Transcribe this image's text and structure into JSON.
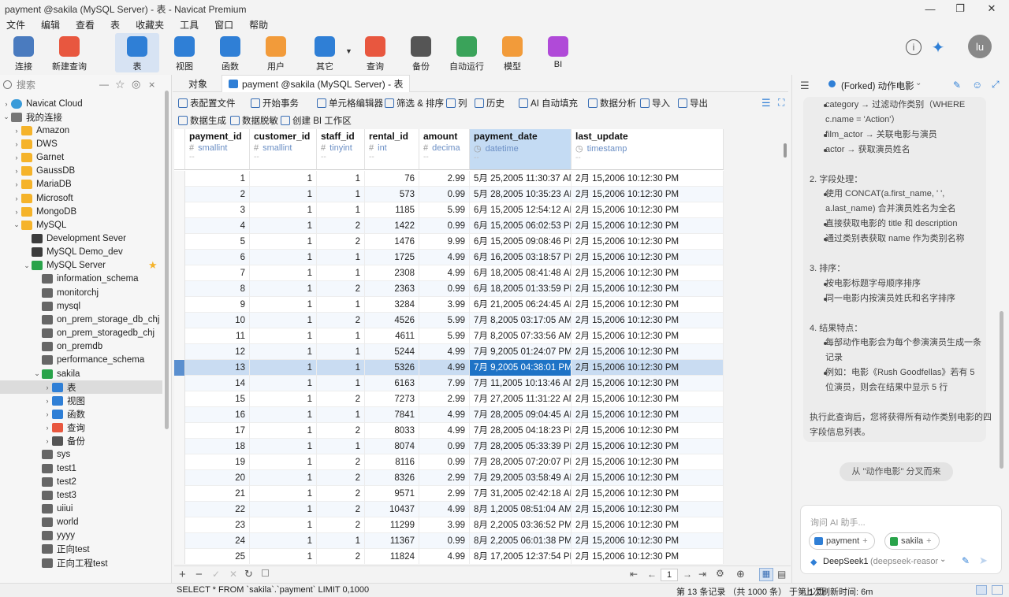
{
  "window": {
    "title": "payment @sakila (MySQL Server) - 表 - Navicat Premium",
    "minimize": "—",
    "maximize": "❐",
    "close": "✕"
  },
  "menu": [
    "文件",
    "编辑",
    "查看",
    "表",
    "收藏夹",
    "工具",
    "窗口",
    "帮助"
  ],
  "toolbar": {
    "items": [
      {
        "label": "连接",
        "icon": "plug-icon",
        "color": "#4a7bbf"
      },
      {
        "label": "新建查询",
        "icon": "new-query-icon",
        "color": "#e8573f"
      },
      {
        "label": "表",
        "icon": "table-icon",
        "color": "#2f7fd6"
      },
      {
        "label": "视图",
        "icon": "view-icon",
        "color": "#2f7fd6"
      },
      {
        "label": "函数",
        "icon": "function-icon",
        "color": "#2f7fd6"
      },
      {
        "label": "用户",
        "icon": "user-icon",
        "color": "#f29b3a"
      },
      {
        "label": "其它",
        "icon": "tools-icon",
        "color": "#2f7fd6"
      },
      {
        "label": "查询",
        "icon": "query-icon",
        "color": "#e8573f"
      },
      {
        "label": "备份",
        "icon": "backup-icon",
        "color": "#555555"
      },
      {
        "label": "自动运行",
        "icon": "robot-icon",
        "color": "#3aa35a"
      },
      {
        "label": "模型",
        "icon": "model-icon",
        "color": "#f29b3a"
      },
      {
        "label": "BI",
        "icon": "bi-icon",
        "color": "#b04ad8"
      }
    ],
    "user_initials": "lu"
  },
  "left": {
    "search_placeholder": "搜索",
    "tree": [
      {
        "label": "Navicat Cloud",
        "indent": 0,
        "icon": "cloud-icon",
        "arrow": "›"
      },
      {
        "label": "我的连接",
        "indent": 0,
        "icon": "connections-icon",
        "arrow": "⌄"
      },
      {
        "label": "Amazon",
        "indent": 1,
        "icon": "folder-icon",
        "arrow": "›"
      },
      {
        "label": "DWS",
        "indent": 1,
        "icon": "folder-icon",
        "arrow": "›"
      },
      {
        "label": "Garnet",
        "indent": 1,
        "icon": "folder-icon",
        "arrow": "›"
      },
      {
        "label": "GaussDB",
        "indent": 1,
        "icon": "folder-icon",
        "arrow": "›"
      },
      {
        "label": "MariaDB",
        "indent": 1,
        "icon": "folder-icon",
        "arrow": "›"
      },
      {
        "label": "Microsoft",
        "indent": 1,
        "icon": "folder-icon",
        "arrow": "›"
      },
      {
        "label": "MongoDB",
        "indent": 1,
        "icon": "folder-icon",
        "arrow": "›"
      },
      {
        "label": "MySQL",
        "indent": 1,
        "icon": "folder-icon",
        "arrow": "⌄"
      },
      {
        "label": "Development Sever",
        "indent": 2,
        "icon": "mysql-connection-icon",
        "arrow": ""
      },
      {
        "label": "MySQL Demo_dev",
        "indent": 2,
        "icon": "mysql-connection-icon",
        "arrow": ""
      },
      {
        "label": "MySQL Server",
        "indent": 2,
        "icon": "mysql-connection-active-icon",
        "arrow": "⌄"
      },
      {
        "label": "information_schema",
        "indent": 3,
        "icon": "database-icon",
        "arrow": ""
      },
      {
        "label": "monitorchj",
        "indent": 3,
        "icon": "database-icon",
        "arrow": ""
      },
      {
        "label": "mysql",
        "indent": 3,
        "icon": "database-icon",
        "arrow": ""
      },
      {
        "label": "on_prem_storage_db_chj",
        "indent": 3,
        "icon": "database-icon",
        "arrow": ""
      },
      {
        "label": "on_prem_storagedb_chj",
        "indent": 3,
        "icon": "database-icon",
        "arrow": ""
      },
      {
        "label": "on_premdb",
        "indent": 3,
        "icon": "database-icon",
        "arrow": ""
      },
      {
        "label": "performance_schema",
        "indent": 3,
        "icon": "database-icon",
        "arrow": ""
      },
      {
        "label": "sakila",
        "indent": 3,
        "icon": "database-open-icon",
        "arrow": "⌄"
      },
      {
        "label": "表",
        "indent": 4,
        "icon": "table-icon",
        "arrow": "›"
      },
      {
        "label": "视图",
        "indent": 4,
        "icon": "view-icon",
        "arrow": "›"
      },
      {
        "label": "函数",
        "indent": 4,
        "icon": "function-icon",
        "arrow": "›"
      },
      {
        "label": "查询",
        "indent": 4,
        "icon": "query-icon",
        "arrow": "›"
      },
      {
        "label": "备份",
        "indent": 4,
        "icon": "backup-icon",
        "arrow": "›"
      },
      {
        "label": "sys",
        "indent": 3,
        "icon": "database-icon",
        "arrow": ""
      },
      {
        "label": "test1",
        "indent": 3,
        "icon": "database-icon",
        "arrow": ""
      },
      {
        "label": "test2",
        "indent": 3,
        "icon": "database-icon",
        "arrow": ""
      },
      {
        "label": "test3",
        "indent": 3,
        "icon": "database-icon",
        "arrow": ""
      },
      {
        "label": "uiiui",
        "indent": 3,
        "icon": "database-icon",
        "arrow": ""
      },
      {
        "label": "world",
        "indent": 3,
        "icon": "database-icon",
        "arrow": ""
      },
      {
        "label": "yyyy",
        "indent": 3,
        "icon": "database-icon",
        "arrow": ""
      },
      {
        "label": "正向test",
        "indent": 3,
        "icon": "database-icon",
        "arrow": ""
      },
      {
        "label": "正向工程test",
        "indent": 3,
        "icon": "database-icon",
        "arrow": ""
      }
    ]
  },
  "tabs": [
    {
      "label": "对象"
    },
    {
      "label": "payment @sakila (MySQL Server) - 表"
    }
  ],
  "table_toolbar": {
    "row1": [
      "表配置文件",
      "开始事务",
      "单元格编辑器",
      "筛选 & 排序",
      "列",
      "历史",
      "AI 自动填充",
      "数据分析",
      "导入",
      "导出"
    ],
    "row2": [
      "数据生成",
      "数据脱敏",
      "创建 BI 工作区"
    ]
  },
  "grid": {
    "columns": [
      {
        "name": "payment_id",
        "type": "smallint",
        "key": "#"
      },
      {
        "name": "customer_id",
        "type": "smallint",
        "key": "#"
      },
      {
        "name": "staff_id",
        "type": "tinyint",
        "key": "#"
      },
      {
        "name": "rental_id",
        "type": "int",
        "key": "#"
      },
      {
        "name": "amount",
        "type": "decima",
        "key": "#"
      },
      {
        "name": "payment_date",
        "type": "datetime",
        "key": "◷"
      },
      {
        "name": "last_update",
        "type": "timestamp",
        "key": "◷"
      }
    ],
    "dash": "--",
    "rows": [
      [
        "1",
        "1",
        "1",
        "76",
        "2.99",
        "5月 25,2005 11:30:37 AM",
        "2月 15,2006 10:12:30 PM"
      ],
      [
        "2",
        "1",
        "1",
        "573",
        "0.99",
        "5月 28,2005 10:35:23 AM",
        "2月 15,2006 10:12:30 PM"
      ],
      [
        "3",
        "1",
        "1",
        "1185",
        "5.99",
        "6月 15,2005 12:54:12 AM",
        "2月 15,2006 10:12:30 PM"
      ],
      [
        "4",
        "1",
        "2",
        "1422",
        "0.99",
        "6月 15,2005 06:02:53 PM",
        "2月 15,2006 10:12:30 PM"
      ],
      [
        "5",
        "1",
        "2",
        "1476",
        "9.99",
        "6月 15,2005 09:08:46 PM",
        "2月 15,2006 10:12:30 PM"
      ],
      [
        "6",
        "1",
        "1",
        "1725",
        "4.99",
        "6月 16,2005 03:18:57 PM",
        "2月 15,2006 10:12:30 PM"
      ],
      [
        "7",
        "1",
        "1",
        "2308",
        "4.99",
        "6月 18,2005 08:41:48 AM",
        "2月 15,2006 10:12:30 PM"
      ],
      [
        "8",
        "1",
        "2",
        "2363",
        "0.99",
        "6月 18,2005 01:33:59 PM",
        "2月 15,2006 10:12:30 PM"
      ],
      [
        "9",
        "1",
        "1",
        "3284",
        "3.99",
        "6月 21,2005 06:24:45 AM",
        "2月 15,2006 10:12:30 PM"
      ],
      [
        "10",
        "1",
        "2",
        "4526",
        "5.99",
        "7月 8,2005 03:17:05 AM",
        "2月 15,2006 10:12:30 PM"
      ],
      [
        "11",
        "1",
        "1",
        "4611",
        "5.99",
        "7月 8,2005 07:33:56 AM",
        "2月 15,2006 10:12:30 PM"
      ],
      [
        "12",
        "1",
        "1",
        "5244",
        "4.99",
        "7月 9,2005 01:24:07 PM",
        "2月 15,2006 10:12:30 PM"
      ],
      [
        "13",
        "1",
        "1",
        "5326",
        "4.99",
        "7月 9,2005 04:38:01 PM",
        "2月 15,2006 10:12:30 PM"
      ],
      [
        "14",
        "1",
        "1",
        "6163",
        "7.99",
        "7月 11,2005 10:13:46 AM",
        "2月 15,2006 10:12:30 PM"
      ],
      [
        "15",
        "1",
        "2",
        "7273",
        "2.99",
        "7月 27,2005 11:31:22 AM",
        "2月 15,2006 10:12:30 PM"
      ],
      [
        "16",
        "1",
        "1",
        "7841",
        "4.99",
        "7月 28,2005 09:04:45 AM",
        "2月 15,2006 10:12:30 PM"
      ],
      [
        "17",
        "1",
        "2",
        "8033",
        "4.99",
        "7月 28,2005 04:18:23 PM",
        "2月 15,2006 10:12:30 PM"
      ],
      [
        "18",
        "1",
        "1",
        "8074",
        "0.99",
        "7月 28,2005 05:33:39 PM",
        "2月 15,2006 10:12:30 PM"
      ],
      [
        "19",
        "1",
        "2",
        "8116",
        "0.99",
        "7月 28,2005 07:20:07 PM",
        "2月 15,2006 10:12:30 PM"
      ],
      [
        "20",
        "1",
        "2",
        "8326",
        "2.99",
        "7月 29,2005 03:58:49 AM",
        "2月 15,2006 10:12:30 PM"
      ],
      [
        "21",
        "1",
        "2",
        "9571",
        "2.99",
        "7月 31,2005 02:42:18 AM",
        "2月 15,2006 10:12:30 PM"
      ],
      [
        "22",
        "1",
        "2",
        "10437",
        "4.99",
        "8月 1,2005 08:51:04 AM",
        "2月 15,2006 10:12:30 PM"
      ],
      [
        "23",
        "1",
        "2",
        "11299",
        "3.99",
        "8月 2,2005 03:36:52 PM",
        "2月 15,2006 10:12:30 PM"
      ],
      [
        "24",
        "1",
        "1",
        "11367",
        "0.99",
        "8月 2,2005 06:01:38 PM",
        "2月 15,2006 10:12:30 PM"
      ],
      [
        "25",
        "1",
        "2",
        "11824",
        "4.99",
        "8月 17,2005 12:37:54 PM",
        "2月 15,2006 10:12:30 PM"
      ]
    ],
    "selected_row": 12
  },
  "grid_bottom": {
    "page": "1"
  },
  "status": {
    "sql": "SELECT * FROM `sakila`.`payment` LIMIT 0,1000",
    "record": "第 13 条记录 （共 1000 条） 于第 1 页",
    "refresh": "上次刷新时间: 6m"
  },
  "ai": {
    "header": "(Forked) 动作电影",
    "lines": [
      {
        "t": "category → 过滤动作类别（WHERE",
        "b": true
      },
      {
        "t": "c.name = 'Action'）",
        "b": false
      },
      {
        "t": "film_actor → 关联电影与演员",
        "b": true
      },
      {
        "t": "actor → 获取演员姓名",
        "b": true
      },
      {
        "t": "",
        "b": false
      },
      {
        "t": "2. 字段处理：",
        "b": false,
        "h": true
      },
      {
        "t": "使用 CONCAT(a.first_name, ' ',",
        "b": true
      },
      {
        "t": "a.last_name) 合并演员姓名为全名",
        "b": false
      },
      {
        "t": "直接获取电影的 title 和 description",
        "b": true
      },
      {
        "t": "通过类别表获取 name 作为类别名称",
        "b": true
      },
      {
        "t": "",
        "b": false
      },
      {
        "t": "3. 排序：",
        "b": false,
        "h": true
      },
      {
        "t": "按电影标题字母顺序排序",
        "b": true
      },
      {
        "t": "同一电影内按演员姓氏和名字排序",
        "b": true
      },
      {
        "t": "",
        "b": false
      },
      {
        "t": "4. 结果特点：",
        "b": false,
        "h": true
      },
      {
        "t": "每部动作电影会为每个参演演员生成一条",
        "b": true
      },
      {
        "t": "记录",
        "b": false
      },
      {
        "t": "例如：电影《Rush Goodfellas》若有 5",
        "b": true
      },
      {
        "t": "位演员，则会在结果中显示 5 行",
        "b": false
      },
      {
        "t": "",
        "b": false
      },
      {
        "t": "执行此查询后，您将获得所有动作类别电影的四",
        "b": false,
        "h": true
      },
      {
        "t": "字段信息列表。",
        "b": false,
        "h": true
      }
    ],
    "fork_button": "从 \"动作电影\" 分叉而来",
    "input_placeholder": "询问 AI 助手...",
    "chip1": "payment",
    "chip2": "sakila",
    "model": "DeepSeek1",
    "model_sub": "(deepseek-reasor"
  }
}
